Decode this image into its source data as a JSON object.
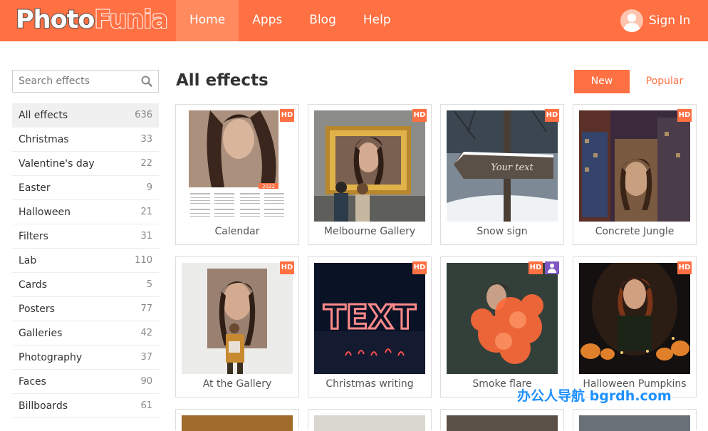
{
  "header": {
    "logo_part1": "Photo",
    "logo_part2": "Funia",
    "nav": [
      {
        "label": "Home",
        "active": true
      },
      {
        "label": "Apps"
      },
      {
        "label": "Blog"
      },
      {
        "label": "Help"
      }
    ],
    "signin_label": "Sign In"
  },
  "sidebar": {
    "search_placeholder": "Search effects",
    "categories": [
      {
        "label": "All effects",
        "count": "636"
      },
      {
        "label": "Christmas",
        "count": "33"
      },
      {
        "label": "Valentine's day",
        "count": "22"
      },
      {
        "label": "Easter",
        "count": "9"
      },
      {
        "label": "Halloween",
        "count": "21"
      },
      {
        "label": "Filters",
        "count": "31"
      },
      {
        "label": "Lab",
        "count": "110"
      },
      {
        "label": "Cards",
        "count": "5"
      },
      {
        "label": "Posters",
        "count": "77"
      },
      {
        "label": "Galleries",
        "count": "42"
      },
      {
        "label": "Photography",
        "count": "37"
      },
      {
        "label": "Faces",
        "count": "90"
      },
      {
        "label": "Billboards",
        "count": "61"
      }
    ]
  },
  "main": {
    "title": "All effects",
    "sort_new": "New",
    "sort_popular": "Popular",
    "hd_label": "HD",
    "effects": [
      {
        "label": "Calendar",
        "calendar_year": "2022"
      },
      {
        "label": "Melbourne Gallery"
      },
      {
        "label": "Snow sign",
        "sign_text": "Your text"
      },
      {
        "label": "Concrete Jungle"
      },
      {
        "label": "At the Gallery"
      },
      {
        "label": "Christmas writing",
        "light_text": "TEXT"
      },
      {
        "label": "Smoke flare"
      },
      {
        "label": "Halloween Pumpkins"
      }
    ]
  },
  "colors": {
    "accent": "#ff7043",
    "user_badge": "#7e57c2"
  },
  "watermark": "办公人导航 bgrdh.com"
}
